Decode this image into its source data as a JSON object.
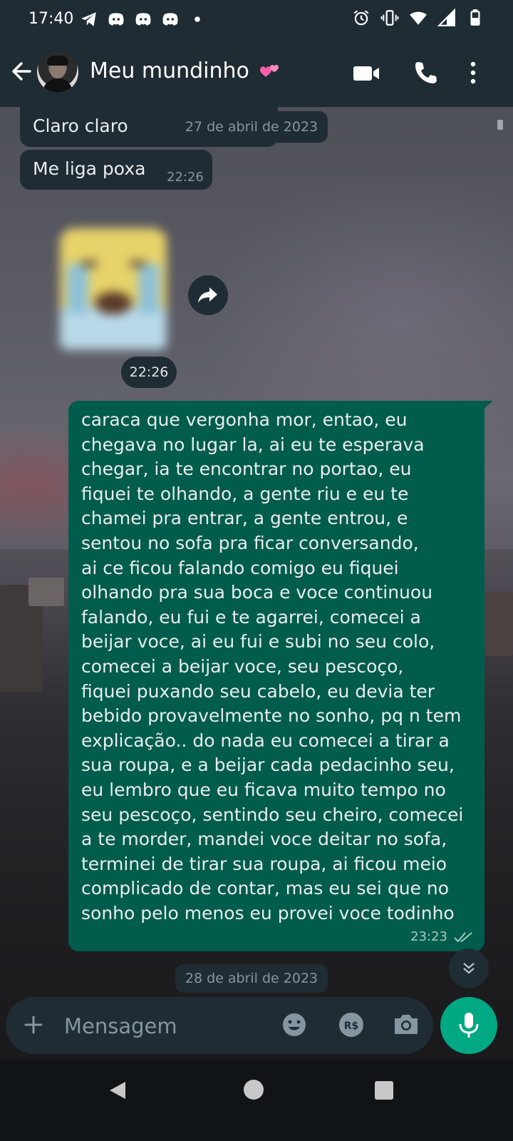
{
  "status_bar": {
    "time": "17:40",
    "left_icons": [
      "telegram-icon",
      "discord-icon",
      "discord-icon",
      "discord-icon",
      "dot-icon"
    ],
    "right_icons": [
      "alarm-icon",
      "vibrate-icon",
      "wifi-icon",
      "signal-icon",
      "battery-icon"
    ]
  },
  "header": {
    "title": "Meu mundinho",
    "title_emoji": "two-hearts-icon",
    "actions": [
      "video-call-icon",
      "voice-call-icon",
      "more-vert-icon"
    ]
  },
  "messages": {
    "incoming": [
      {
        "text": "Claro claro",
        "time": ""
      },
      {
        "text": "Me liga poxa",
        "time": "22:26"
      }
    ],
    "date_chip_1": "27 de abril de 2023",
    "sticker_time": "22:26",
    "outgoing": {
      "text": "caraca que vergonha mor, entao, eu\nchegava no lugar la, ai eu te esperava\nchegar, ia te encontrar no portao, eu\nfiquei te olhando, a gente riu e eu te\nchamei pra entrar, a gente entrou, e\nsentou no sofa pra ficar conversando,\nai ce ficou falando comigo eu fiquei\nolhando pra sua boca e voce continuou\nfalando, eu fui e te agarrei, comecei a\nbeijar voce, ai eu fui e subi no seu colo,\ncomecei a beijar voce, seu pescoço,\nfiquei puxando seu cabelo, eu devia ter\nbebido provavelmente no sonho, pq n tem\nexplicação.. do nada eu comecei a tirar a\nsua roupa, e a beijar cada pedacinho seu,\neu lembro que eu ficava muito tempo no\nseu pescoço, sentindo seu cheiro, comecei\na te morder, mandei voce deitar no sofa,\nterminei de tirar sua roupa, ai ficou meio\ncomplicado de contar, mas eu sei que no\nsonho pelo menos eu provei voce todinho",
      "time": "23:23",
      "status": "read"
    },
    "date_chip_2": "28 de abril de 2023"
  },
  "composer": {
    "placeholder": "Mensagem"
  },
  "colors": {
    "header_bg": "#1f2c34",
    "incoming_bubble": "#1f2c34",
    "outgoing_bubble": "#005c4b",
    "accent": "#00a884",
    "meta_text": "#8696a0"
  }
}
